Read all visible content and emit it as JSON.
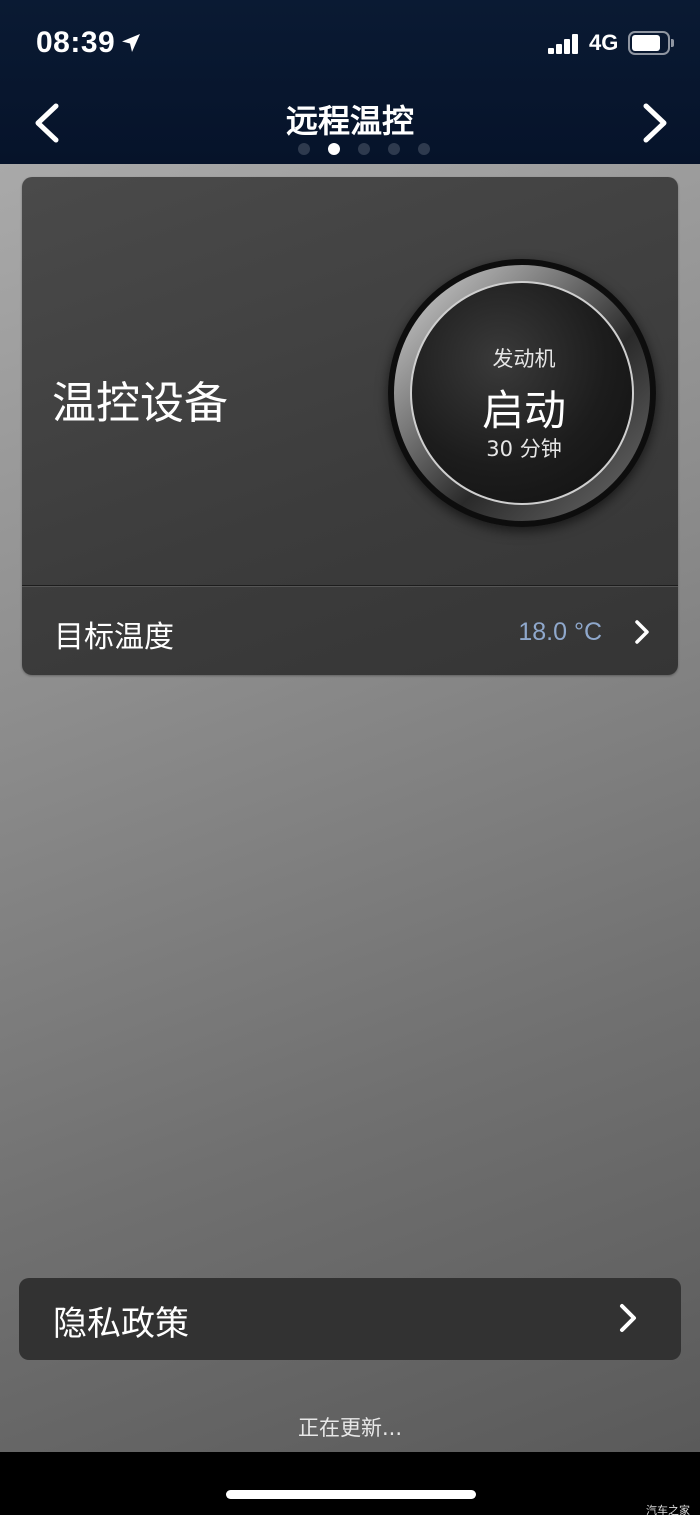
{
  "status_bar": {
    "time": "08:39",
    "network": "4G"
  },
  "nav": {
    "title": "远程温控",
    "page_count": 5,
    "active_page": 2
  },
  "climate_card": {
    "device_label": "温控设备",
    "engine": {
      "subtitle": "发动机",
      "action": "启动",
      "duration": "30 分钟"
    },
    "target_temperature": {
      "label": "目标温度",
      "value": "18.0 °C",
      "value_color": "#8fa8cc"
    }
  },
  "privacy": {
    "label": "隐私政策"
  },
  "footer": {
    "status_text": "正在更新...",
    "watermark": "汽车之家"
  },
  "icons": {
    "back": "chevron-left-icon",
    "next": "chevron-right-icon",
    "location": "location-arrow-icon",
    "signal": "cellular-signal-icon",
    "battery": "battery-icon"
  }
}
